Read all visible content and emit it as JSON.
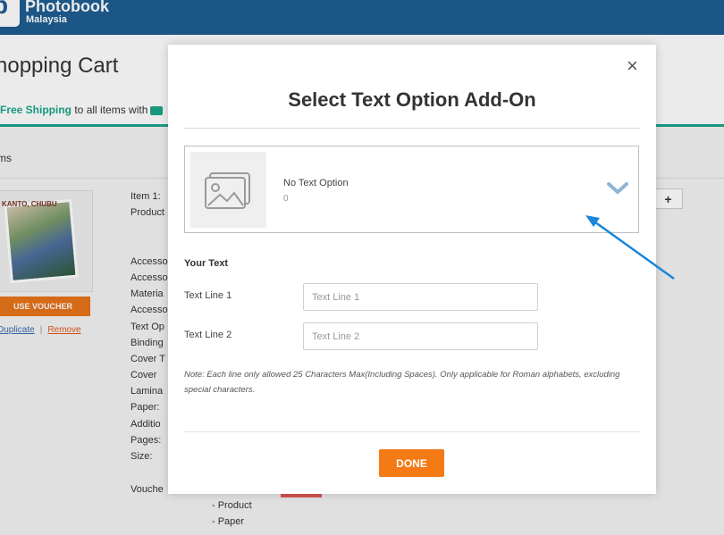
{
  "header": {
    "logo_letter": "p",
    "brand": "Photobook",
    "brand_sub": "Malaysia",
    "bg_color": "#1e5e93"
  },
  "page": {
    "title": "hopping Cart",
    "shipping_bold": "Free Shipping",
    "shipping_rest": " to all items with",
    "shipping_tail": "...",
    "items_heading": "ms",
    "thumb_text": "KANTO, CHUBU",
    "use_voucher": "USE VOUCHER",
    "duplicate": "Duplicate",
    "remove": "Remove",
    "plus": "+",
    "item_label": "Item 1:",
    "detail_labels": [
      "Product",
      "Accesso",
      "Accesso",
      "Materia",
      "Accesso",
      "Text Op",
      "Binding",
      "Cover T",
      "Cover",
      "Lamina",
      "Paper:",
      "Additio",
      "Pages:",
      "Size:",
      "Vouche"
    ],
    "voucher_sub": [
      "- Product",
      "- Paper"
    ]
  },
  "modal": {
    "close_glyph": "×",
    "title": "Select Text Option Add-On",
    "option": {
      "name": "No Text Option",
      "price": "0",
      "image_icon": "image-placeholder-icon",
      "expand_icon": "chevron-down-icon"
    },
    "your_text_label": "Your Text",
    "line1_label": "Text Line 1",
    "line1_placeholder": "Text Line 1",
    "line1_value": "",
    "line2_label": "Text Line 2",
    "line2_placeholder": "Text Line 2",
    "line2_value": "",
    "note": "Note: Each line only allowed 25 Characters Max(Including Spaces). Only applicable for Roman alphabets, excluding special characters.",
    "done_label": "DONE"
  },
  "colors": {
    "accent_orange": "#f47a15",
    "green": "#1ba58a",
    "arrow": "#1a86d8"
  }
}
